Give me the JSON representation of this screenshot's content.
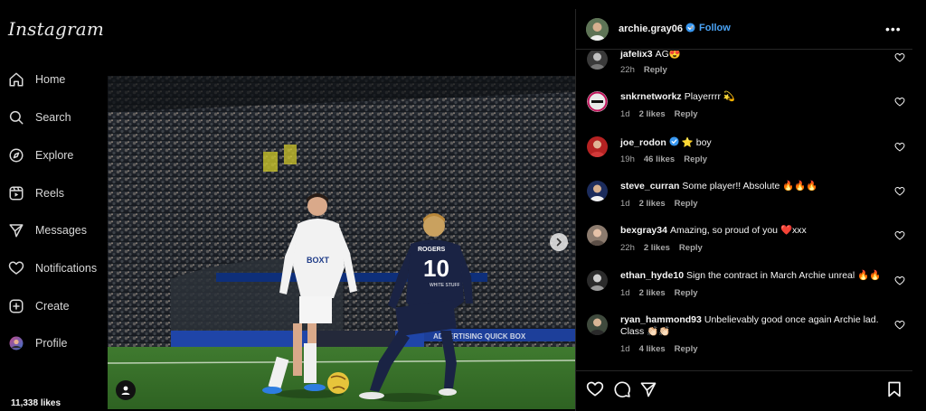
{
  "app": {
    "logo": "Instagram"
  },
  "nav": {
    "items": [
      {
        "label": "Home",
        "icon": "home-icon"
      },
      {
        "label": "Search",
        "icon": "search-icon"
      },
      {
        "label": "Explore",
        "icon": "compass-icon"
      },
      {
        "label": "Reels",
        "icon": "reels-icon"
      },
      {
        "label": "Messages",
        "icon": "send-icon"
      },
      {
        "label": "Notifications",
        "icon": "heart-icon"
      },
      {
        "label": "Create",
        "icon": "plus-square-icon"
      },
      {
        "label": "Profile",
        "icon": "avatar-icon"
      }
    ]
  },
  "post": {
    "author": "archie.gray06",
    "verified": true,
    "follow_label": "Follow",
    "dot": "•",
    "more": "•••",
    "photo": {
      "home_shirt": "BOXT",
      "away_name": "ROGERS",
      "away_number": "10",
      "away_sponsor": "WHITE STUFF",
      "board_text": "ADVERTISING QUICK BOX"
    },
    "likes_partial": "11,338 likes"
  },
  "comments": [
    {
      "user": "jafelix3",
      "text": "AG😍",
      "time": "22h",
      "likes": "",
      "reply": "Reply",
      "verified": false
    },
    {
      "user": "snkrnetworkz",
      "text": "Playerrrr 💫",
      "time": "1d",
      "likes": "2 likes",
      "reply": "Reply",
      "verified": false
    },
    {
      "user": "joe_rodon",
      "text": "⭐ boy",
      "time": "19h",
      "likes": "46 likes",
      "reply": "Reply",
      "verified": true
    },
    {
      "user": "steve_curran",
      "text": "Some player!! Absolute 🔥🔥🔥",
      "time": "1d",
      "likes": "2 likes",
      "reply": "Reply",
      "verified": false
    },
    {
      "user": "bexgray34",
      "text": "Amazing, so proud of you ❤️xxx",
      "time": "22h",
      "likes": "2 likes",
      "reply": "Reply",
      "verified": false
    },
    {
      "user": "ethan_hyde10",
      "text": "Sign the contract in March Archie unreal 🔥🔥",
      "time": "1d",
      "likes": "2 likes",
      "reply": "Reply",
      "verified": false
    },
    {
      "user": "ryan_hammond93",
      "text": "Unbelievably good once again Archie lad. Class 👏🏻👏🏻",
      "time": "1d",
      "likes": "4 likes",
      "reply": "Reply",
      "verified": false
    }
  ],
  "colors": {
    "accent": "#4aa3f5",
    "muted": "#a8a8a8",
    "background": "#000000",
    "border": "#262626"
  }
}
